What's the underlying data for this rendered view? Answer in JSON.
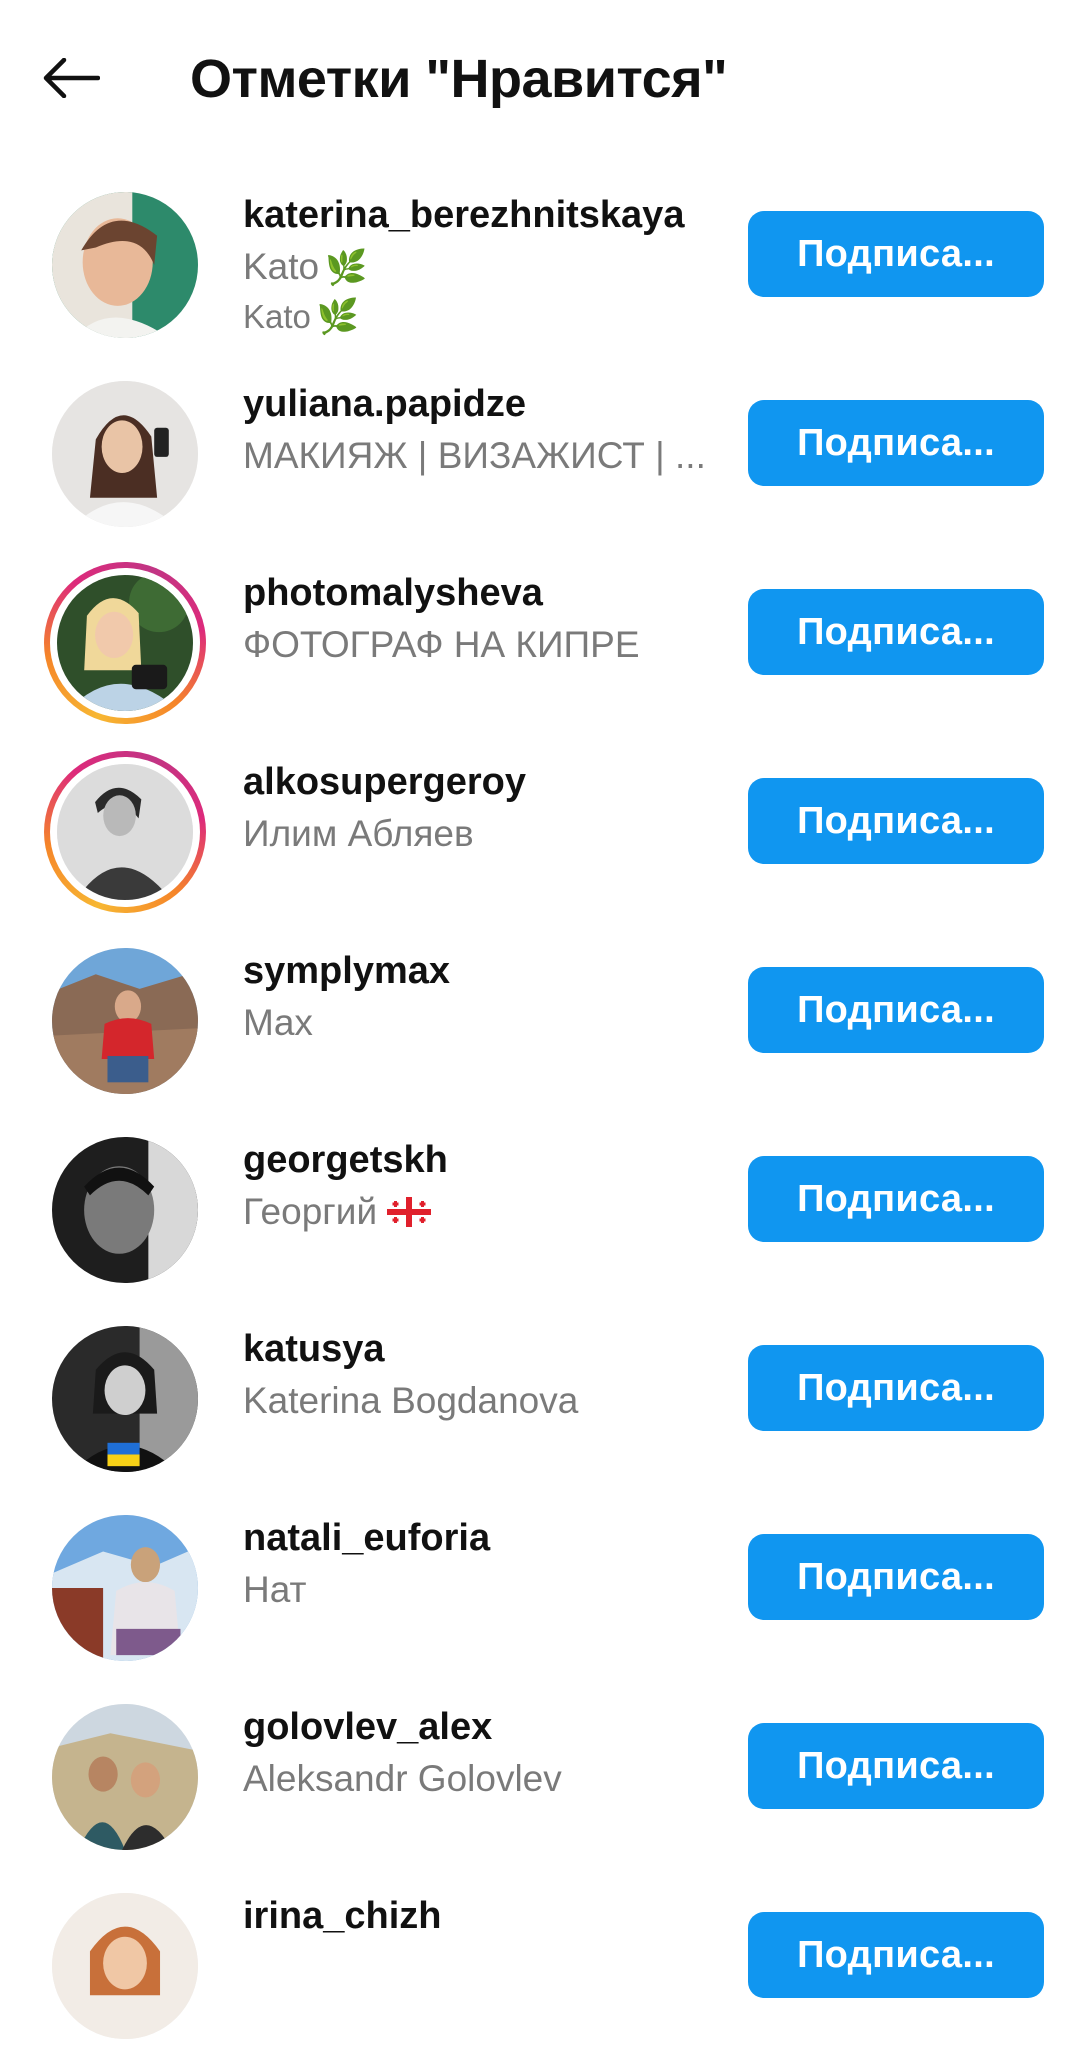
{
  "header": {
    "title": "Отметки \"Нравится\"",
    "back_icon": "arrow-left-icon"
  },
  "follow_label": "Подписа...",
  "users": [
    {
      "username": "katerina_berezhnitskaya",
      "fullname": "Kato",
      "extra": "Kato",
      "name_icon": "leaf-icon",
      "story": false
    },
    {
      "username": "yuliana.papidze",
      "fullname": "МАКИЯЖ | ВИЗАЖИСТ | ...",
      "story": false
    },
    {
      "username": "photomalysheva",
      "fullname": "ФОТОГРАФ НА КИПРЕ",
      "story": true
    },
    {
      "username": "alkosupergeroy",
      "fullname": "Илим Абляев",
      "story": true
    },
    {
      "username": "symplymax",
      "fullname": "Max",
      "story": false
    },
    {
      "username": "georgetskh",
      "fullname": "Георгий",
      "name_icon": "georgia-flag-icon",
      "story": false
    },
    {
      "username": "katusya",
      "fullname": "Katerina Bogdanova",
      "story": false
    },
    {
      "username": "natali_euforia",
      "fullname": "Нат",
      "story": false
    },
    {
      "username": "golovlev_alex",
      "fullname": "Aleksandr  Golovlev",
      "story": false
    },
    {
      "username": "irina_chizh",
      "fullname": "",
      "story": false
    }
  ],
  "colors": {
    "follow_button": "#1096f0",
    "secondary_text": "#7a7a7a",
    "story_ring": [
      "#f7b733",
      "#dd2a7b",
      "#c13584"
    ]
  }
}
